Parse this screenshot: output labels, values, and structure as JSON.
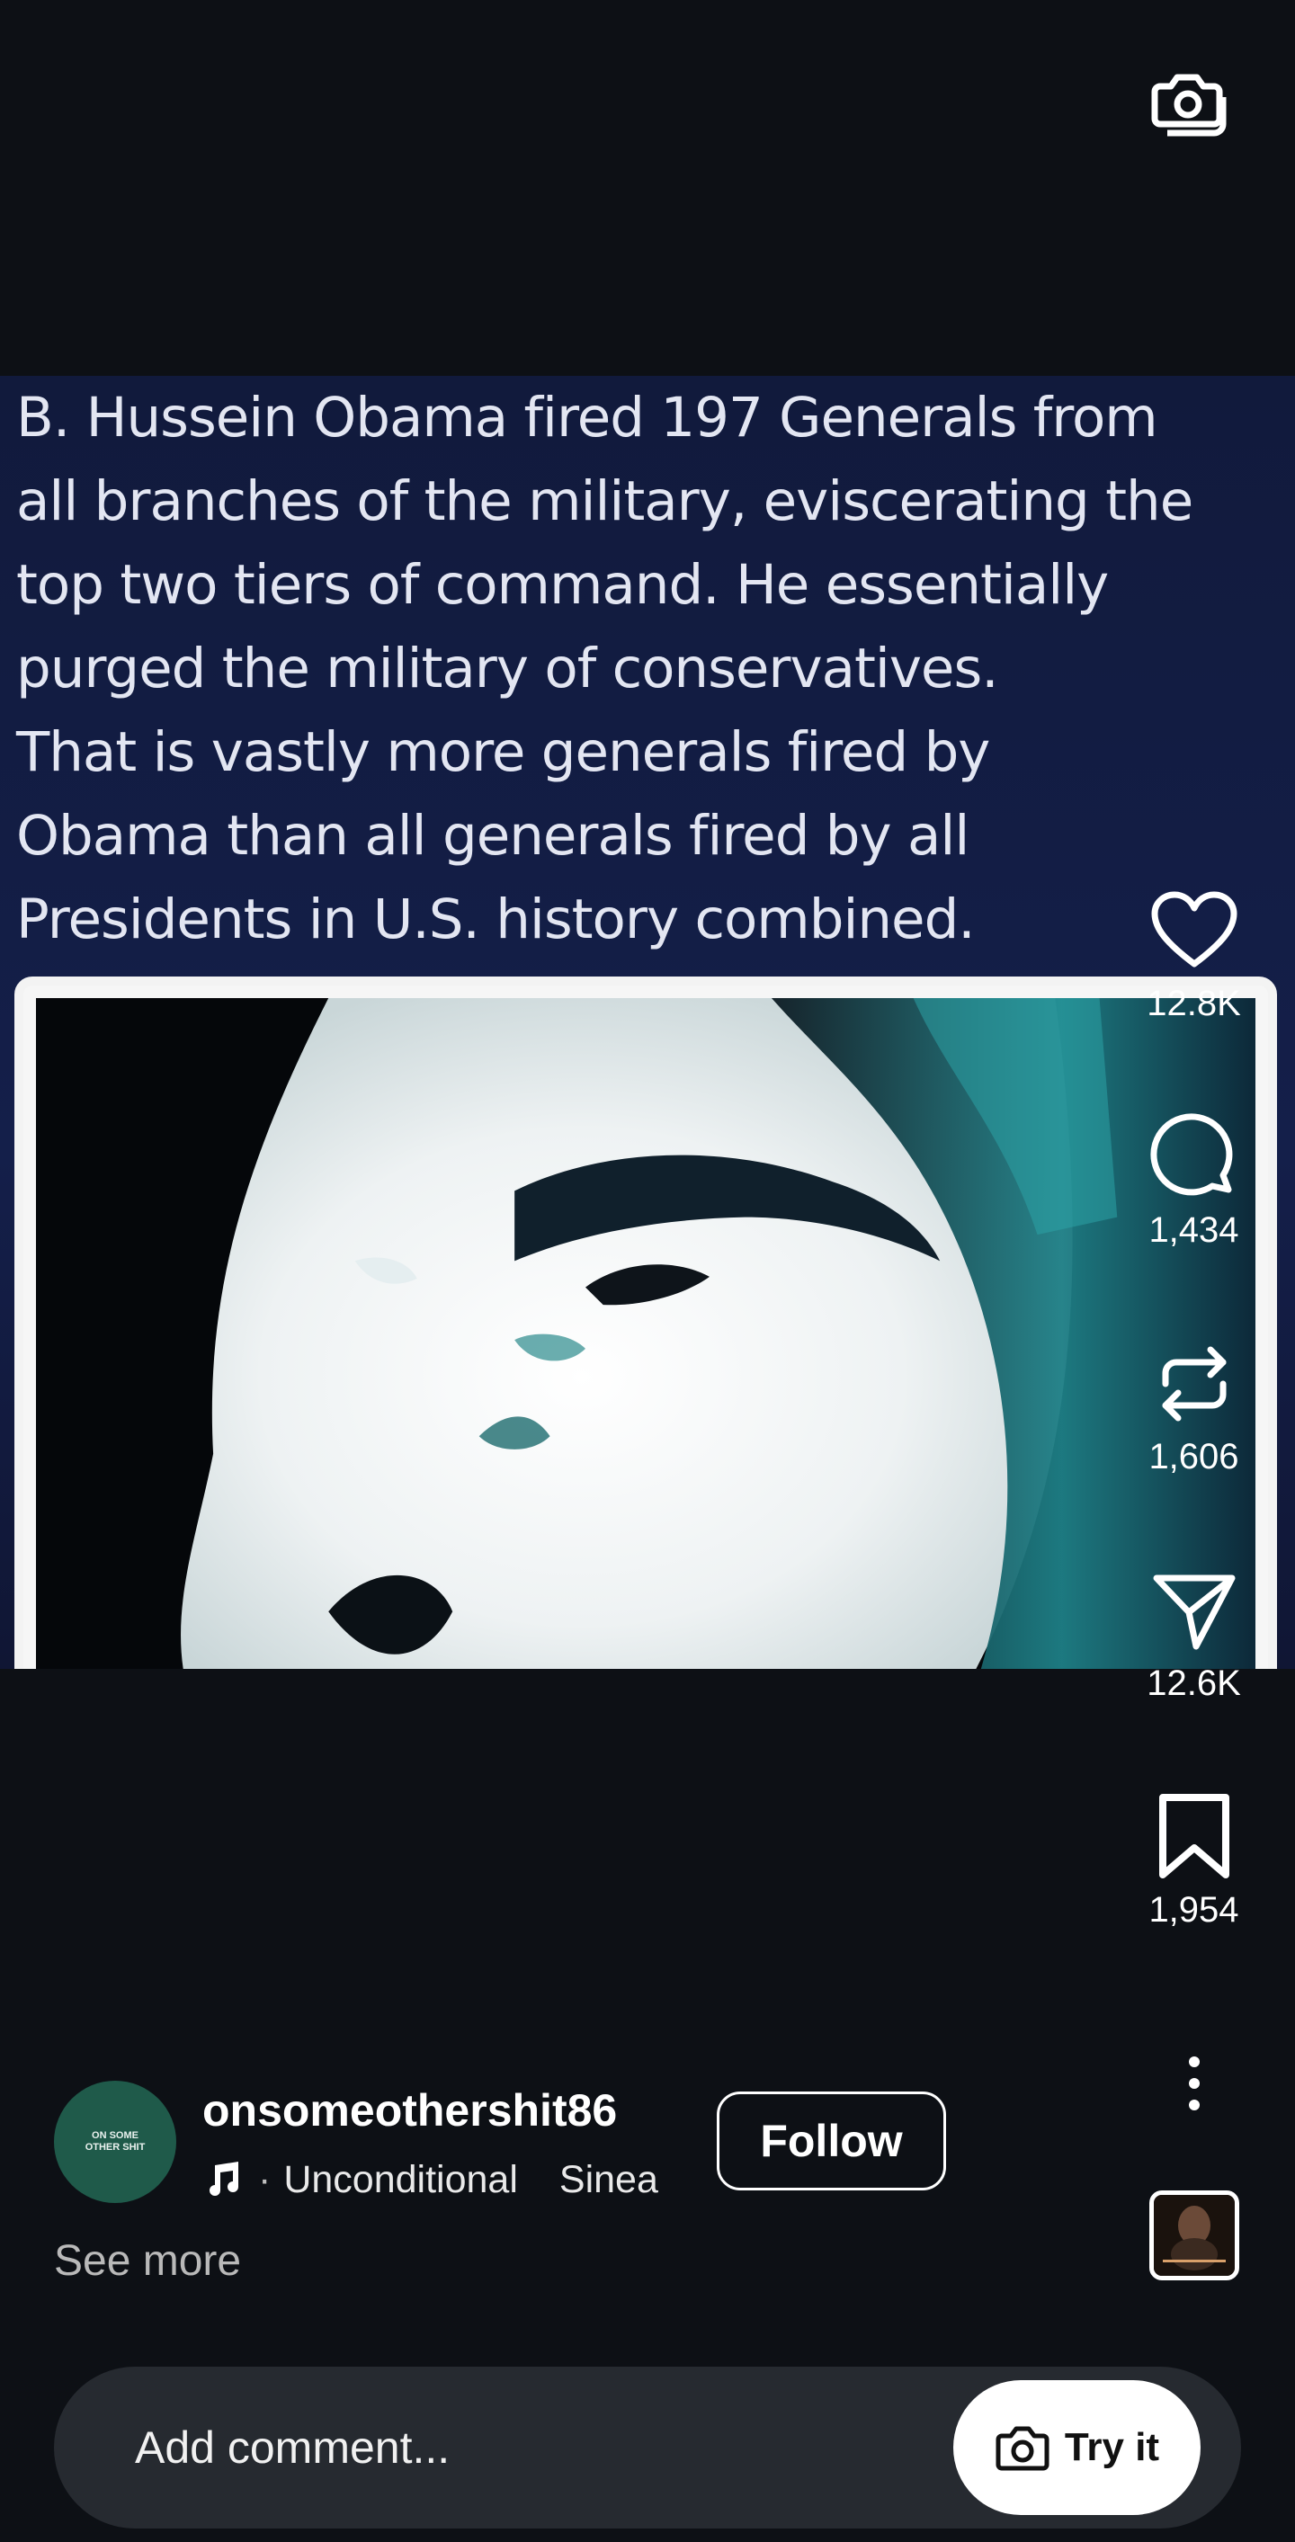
{
  "post": {
    "caption_lines": [
      "B. Hussein Obama fired 197 Generals from",
      "all branches of the military, eviscerating the",
      "top two tiers of command. He essentially",
      "purged the military of conservatives.",
      "That is vastly more generals fired by",
      "Obama than all generals fired by all",
      "Presidents in U.S. history combined."
    ]
  },
  "actions": {
    "likes": "12.8K",
    "comments": "1,434",
    "reposts": "1,606",
    "shares": "12.6K",
    "saves": "1,954"
  },
  "author": {
    "avatar_text": "ON SOME OTHER SHIT",
    "username": "onsomeothershit86",
    "follow_label": "Follow"
  },
  "music": {
    "song": "Unconditional",
    "artist": "Sinea"
  },
  "see_more": "See more",
  "comment": {
    "placeholder": "Add comment...",
    "try_label": "Try it"
  },
  "icons": {
    "top": "camera-stack-icon",
    "like": "heart-icon",
    "comment": "comment-bubble-icon",
    "repost": "repost-icon",
    "share": "send-icon",
    "save": "bookmark-icon",
    "more": "more-vertical-icon",
    "music": "music-note-icon",
    "try": "camera-icon"
  }
}
